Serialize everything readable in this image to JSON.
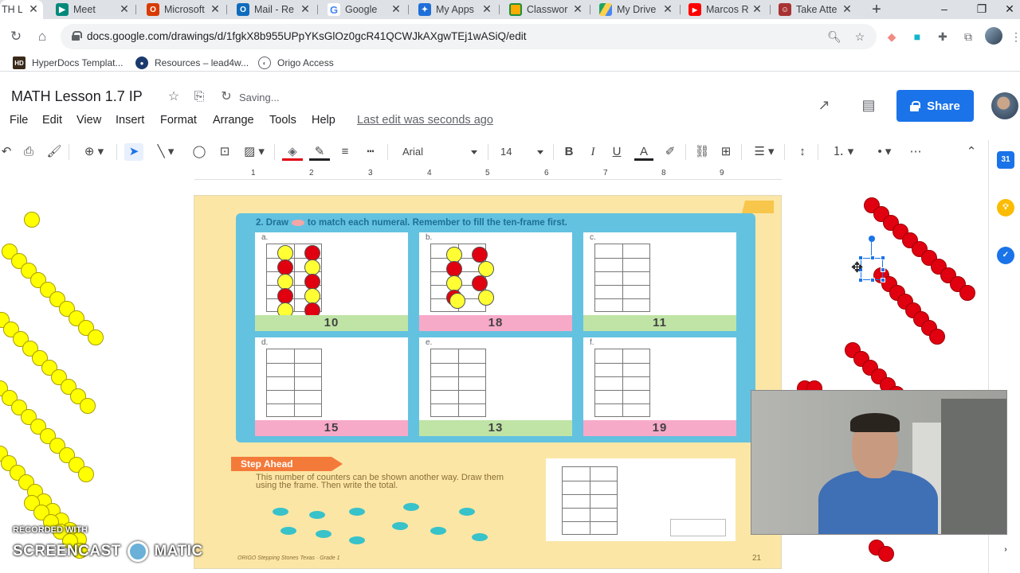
{
  "browser": {
    "tabs": [
      {
        "label": "TH Le",
        "icon": "docs-drawing-icon",
        "color": "#ffffff",
        "active": true
      },
      {
        "label": "Meet",
        "icon": "meet-icon",
        "color": "#00897b"
      },
      {
        "label": "Microsoft",
        "icon": "office-icon",
        "color": "#d83b01"
      },
      {
        "label": "Mail - Re",
        "icon": "outlook-icon",
        "color": "#0f6cbd"
      },
      {
        "label": "Google",
        "icon": "google-icon",
        "color": "#4285f4"
      },
      {
        "label": "My Apps",
        "icon": "my-apps-icon",
        "color": "#1e6fd9"
      },
      {
        "label": "Classwor",
        "icon": "classroom-icon",
        "color": "#f9ab00"
      },
      {
        "label": "My Drive",
        "icon": "drive-icon",
        "color": "#1fa463"
      },
      {
        "label": "Marcos R",
        "icon": "youtube-icon",
        "color": "#ff0000"
      },
      {
        "label": "Take Atte",
        "icon": "attendance-icon",
        "color": "#a83232"
      }
    ],
    "new_tab": "+",
    "url": "docs.google.com/drawings/d/1fgkX8b955UPpYKsGlOz0gcR41QCWJkAXgwTEj1wASiQ/edit",
    "bookmarks": [
      {
        "label": "HyperDocs Templat...",
        "icon": "hyperdocs-icon"
      },
      {
        "label": "Resources – lead4w...",
        "icon": "globe-icon"
      },
      {
        "label": "Origo Access",
        "icon": "globe-icon"
      }
    ]
  },
  "docs": {
    "title": "MATH  Lesson 1.7 IP",
    "saving": "Saving...",
    "menu": [
      "File",
      "Edit",
      "View",
      "Insert",
      "Format",
      "Arrange",
      "Tools",
      "Help"
    ],
    "last_edit": "Last edit was seconds ago",
    "share_label": "Share",
    "font": "Arial",
    "font_size": "14",
    "ruler_numbers": [
      "1",
      "2",
      "3",
      "4",
      "5",
      "6",
      "7",
      "8",
      "9"
    ]
  },
  "worksheet": {
    "instruction_prefix": "2.  Draw",
    "instruction_suffix": "to match each numeral. Remember to fill the ten-frame first.",
    "cells": [
      {
        "letter": "a.",
        "numeral": "10",
        "band": "green"
      },
      {
        "letter": "b.",
        "numeral": "18",
        "band": "pink"
      },
      {
        "letter": "c.",
        "numeral": "11",
        "band": "green"
      },
      {
        "letter": "d.",
        "numeral": "15",
        "band": "pink"
      },
      {
        "letter": "e.",
        "numeral": "13",
        "band": "green"
      },
      {
        "letter": "f.",
        "numeral": "19",
        "band": "pink"
      }
    ],
    "step_ahead_title": "Step Ahead",
    "step_ahead_text": "This number of counters can be shown another way. Draw them using the frame. Then write the total.",
    "footer_left": "ORIGO Stepping Stones Texas · Grade 1",
    "page_number": "21"
  },
  "watermark": {
    "small": "RECORDED WITH",
    "big_left": "SCREENCAST",
    "big_right": "MATIC"
  },
  "colors": {
    "share": "#1a73e8",
    "counter_yellow": "#ffff33",
    "counter_red": "#e0000f",
    "panel_blue": "#63c2e0",
    "slide_bg": "#fbe6a6"
  }
}
